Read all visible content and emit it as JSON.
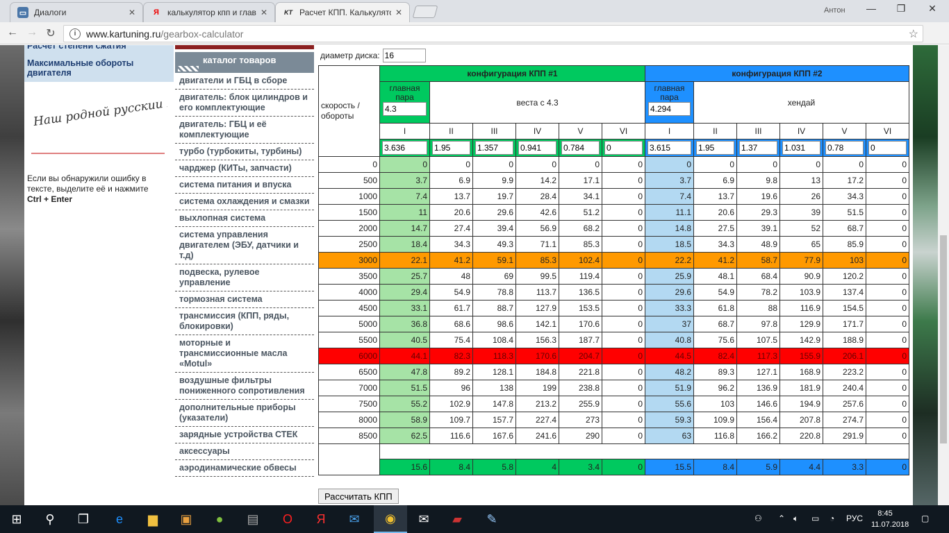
{
  "browser": {
    "tabs": [
      {
        "label": "Диалоги",
        "icon": "dialog-icon"
      },
      {
        "label": "калькулятор кпп и главн",
        "icon": "yandex-icon"
      },
      {
        "label": "Расчет КПП. Калькулятор",
        "icon": "kt-icon"
      }
    ],
    "user": "Антон",
    "url_host": "www.kartuning.ru",
    "url_path": "/gearbox-calculator"
  },
  "left": {
    "links": [
      "Расчет степени сжатия",
      "Максимальные обороты двигателя"
    ],
    "slogan": "Наш родной русский язык",
    "error_text": "Если вы обнаружили ошибку в тексте, выделите её и нажмите",
    "error_keys": "Ctrl + Enter"
  },
  "catalog": {
    "title": "каталог товаров",
    "items": [
      "двигатели и ГБЦ в сборе",
      "двигатель: блок цилиндров и его комплектующие",
      "двигатель: ГБЦ и её комплектующие",
      "турбо (турбокиты, турбины)",
      "чарджер (КИТы, запчасти)",
      "система питания и впуска",
      "система охлаждения и смазки",
      "выхлопная система",
      "система управления двигателем (ЭБУ, датчики и т.д)",
      "подвеска, рулевое управление",
      "тормозная система",
      "трансмиссия (КПП, ряды, блокировки)",
      "моторные и трансмиссионные масла «Motul»",
      "воздушные фильтры пониженного сопротивления",
      "дополнительные приборы (указатели)",
      "зарядные устройства СТЕК",
      "аксессуары",
      "аэродинамические обвесы"
    ]
  },
  "calc": {
    "disk_label": "диаметр диска:",
    "disk_value": "16",
    "speed_label": "скорость / обороты",
    "main_pair_label": "главная пара",
    "cfg1": {
      "title": "конфигурация КПП #1",
      "main_pair": "4.3",
      "name": "веста с 4.3",
      "ratios": [
        "3.636",
        "1.95",
        "1.357",
        "0.941",
        "0.784",
        "0"
      ]
    },
    "cfg2": {
      "title": "конфигурация КПП #2",
      "main_pair": "4.294",
      "name": "хендай",
      "ratios": [
        "3.615",
        "1.95",
        "1.37",
        "1.031",
        "0.78",
        "0"
      ]
    },
    "gears": [
      "I",
      "II",
      "III",
      "IV",
      "V",
      "VI"
    ],
    "rows": [
      {
        "rpm": "0",
        "c1": [
          "0",
          "0",
          "0",
          "0",
          "0",
          "0"
        ],
        "c2": [
          "0",
          "0",
          "0",
          "0",
          "0",
          "0"
        ]
      },
      {
        "rpm": "500",
        "c1": [
          "3.7",
          "6.9",
          "9.9",
          "14.2",
          "17.1",
          "0"
        ],
        "c2": [
          "3.7",
          "6.9",
          "9.8",
          "13",
          "17.2",
          "0"
        ]
      },
      {
        "rpm": "1000",
        "c1": [
          "7.4",
          "13.7",
          "19.7",
          "28.4",
          "34.1",
          "0"
        ],
        "c2": [
          "7.4",
          "13.7",
          "19.6",
          "26",
          "34.3",
          "0"
        ]
      },
      {
        "rpm": "1500",
        "c1": [
          "11",
          "20.6",
          "29.6",
          "42.6",
          "51.2",
          "0"
        ],
        "c2": [
          "11.1",
          "20.6",
          "29.3",
          "39",
          "51.5",
          "0"
        ]
      },
      {
        "rpm": "2000",
        "c1": [
          "14.7",
          "27.4",
          "39.4",
          "56.9",
          "68.2",
          "0"
        ],
        "c2": [
          "14.8",
          "27.5",
          "39.1",
          "52",
          "68.7",
          "0"
        ]
      },
      {
        "rpm": "2500",
        "c1": [
          "18.4",
          "34.3",
          "49.3",
          "71.1",
          "85.3",
          "0"
        ],
        "c2": [
          "18.5",
          "34.3",
          "48.9",
          "65",
          "85.9",
          "0"
        ]
      },
      {
        "rpm": "3000",
        "c1": [
          "22.1",
          "41.2",
          "59.1",
          "85.3",
          "102.4",
          "0"
        ],
        "c2": [
          "22.2",
          "41.2",
          "58.7",
          "77.9",
          "103",
          "0"
        ],
        "hl": "orange"
      },
      {
        "rpm": "3500",
        "c1": [
          "25.7",
          "48",
          "69",
          "99.5",
          "119.4",
          "0"
        ],
        "c2": [
          "25.9",
          "48.1",
          "68.4",
          "90.9",
          "120.2",
          "0"
        ]
      },
      {
        "rpm": "4000",
        "c1": [
          "29.4",
          "54.9",
          "78.8",
          "113.7",
          "136.5",
          "0"
        ],
        "c2": [
          "29.6",
          "54.9",
          "78.2",
          "103.9",
          "137.4",
          "0"
        ]
      },
      {
        "rpm": "4500",
        "c1": [
          "33.1",
          "61.7",
          "88.7",
          "127.9",
          "153.5",
          "0"
        ],
        "c2": [
          "33.3",
          "61.8",
          "88",
          "116.9",
          "154.5",
          "0"
        ]
      },
      {
        "rpm": "5000",
        "c1": [
          "36.8",
          "68.6",
          "98.6",
          "142.1",
          "170.6",
          "0"
        ],
        "c2": [
          "37",
          "68.7",
          "97.8",
          "129.9",
          "171.7",
          "0"
        ]
      },
      {
        "rpm": "5500",
        "c1": [
          "40.5",
          "75.4",
          "108.4",
          "156.3",
          "187.7",
          "0"
        ],
        "c2": [
          "40.8",
          "75.6",
          "107.5",
          "142.9",
          "188.9",
          "0"
        ]
      },
      {
        "rpm": "6000",
        "c1": [
          "44.1",
          "82.3",
          "118.3",
          "170.6",
          "204.7",
          "0"
        ],
        "c2": [
          "44.5",
          "82.4",
          "117.3",
          "155.9",
          "206.1",
          "0"
        ],
        "hl": "red"
      },
      {
        "rpm": "6500",
        "c1": [
          "47.8",
          "89.2",
          "128.1",
          "184.8",
          "221.8",
          "0"
        ],
        "c2": [
          "48.2",
          "89.3",
          "127.1",
          "168.9",
          "223.2",
          "0"
        ]
      },
      {
        "rpm": "7000",
        "c1": [
          "51.5",
          "96",
          "138",
          "199",
          "238.8",
          "0"
        ],
        "c2": [
          "51.9",
          "96.2",
          "136.9",
          "181.9",
          "240.4",
          "0"
        ]
      },
      {
        "rpm": "7500",
        "c1": [
          "55.2",
          "102.9",
          "147.8",
          "213.2",
          "255.9",
          "0"
        ],
        "c2": [
          "55.6",
          "103",
          "146.6",
          "194.9",
          "257.6",
          "0"
        ]
      },
      {
        "rpm": "8000",
        "c1": [
          "58.9",
          "109.7",
          "157.7",
          "227.4",
          "273",
          "0"
        ],
        "c2": [
          "59.3",
          "109.9",
          "156.4",
          "207.8",
          "274.7",
          "0"
        ]
      },
      {
        "rpm": "8500",
        "c1": [
          "62.5",
          "116.6",
          "167.6",
          "241.6",
          "290",
          "0"
        ],
        "c2": [
          "63",
          "116.8",
          "166.2",
          "220.8",
          "291.9",
          "0"
        ]
      }
    ],
    "totals": {
      "c1": [
        "15.6",
        "8.4",
        "5.8",
        "4",
        "3.4",
        "0"
      ],
      "c2": [
        "15.5",
        "8.4",
        "5.9",
        "4.4",
        "3.3",
        "0"
      ]
    },
    "button": "Рассчитать КПП"
  },
  "taskbar": {
    "lang": "РУС",
    "time": "8:45",
    "date": "11.07.2018"
  }
}
